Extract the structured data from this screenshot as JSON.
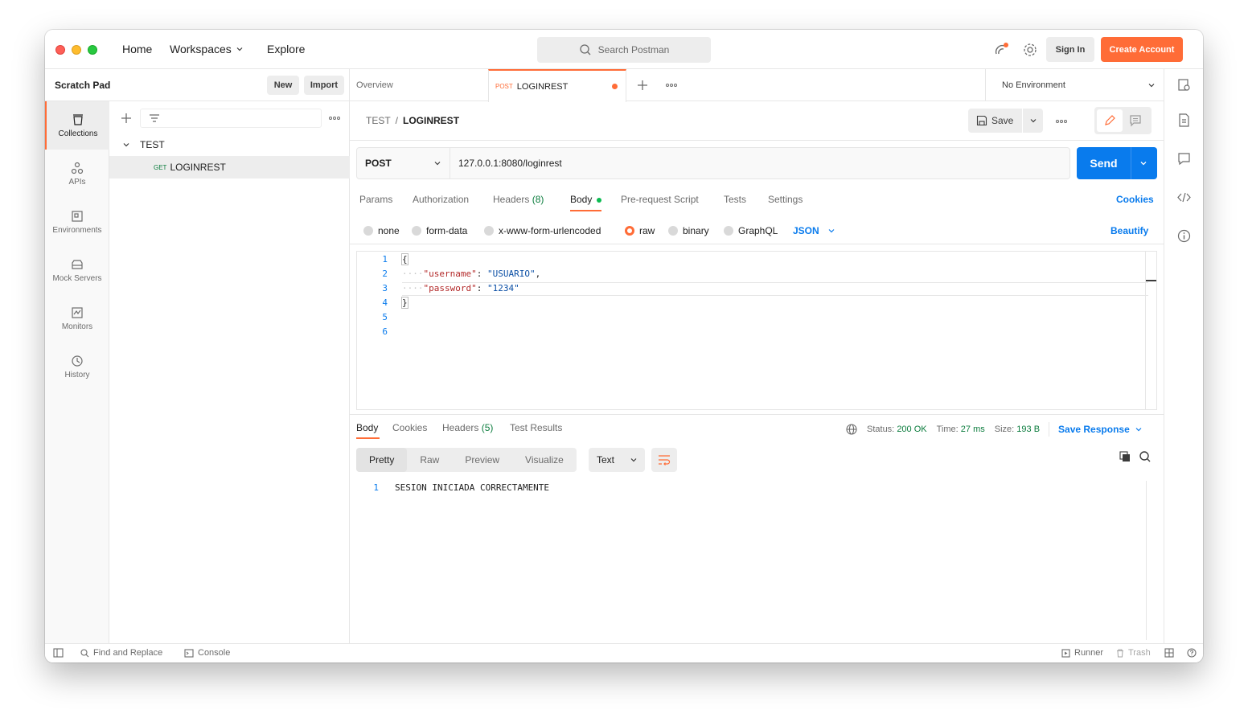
{
  "nav": {
    "home": "Home",
    "workspaces": "Workspaces",
    "explore": "Explore"
  },
  "search": {
    "placeholder": "Search Postman"
  },
  "account": {
    "sign_in": "Sign In",
    "create_account": "Create Account"
  },
  "sidebar": {
    "title": "Scratch Pad",
    "new_label": "New",
    "import_label": "Import",
    "items": [
      {
        "label": "Collections",
        "icon": "collections-icon"
      },
      {
        "label": "APIs",
        "icon": "apis-icon"
      },
      {
        "label": "Environments",
        "icon": "environments-icon"
      },
      {
        "label": "Mock Servers",
        "icon": "mock-servers-icon"
      },
      {
        "label": "Monitors",
        "icon": "monitors-icon"
      },
      {
        "label": "History",
        "icon": "history-icon"
      }
    ]
  },
  "collections": {
    "name": "TEST",
    "requests": [
      {
        "method": "GET",
        "name": "LOGINREST"
      }
    ]
  },
  "tabs": {
    "overview": "Overview",
    "active_method": "POST",
    "active_name": "LOGINREST",
    "environment": "No Environment"
  },
  "request": {
    "breadcrumb_collection": "TEST",
    "breadcrumb_separator": "/",
    "breadcrumb_name": "LOGINREST",
    "save_label": "Save",
    "method": "POST",
    "url": "127.0.0.1:8080/loginrest",
    "send_label": "Send",
    "tabs": {
      "params": "Params",
      "authorization": "Authorization",
      "headers": "Headers",
      "headers_count": "(8)",
      "body": "Body",
      "pre_request": "Pre-request Script",
      "tests": "Tests",
      "settings": "Settings",
      "cookies": "Cookies"
    },
    "body_types": {
      "none": "none",
      "form_data": "form-data",
      "urlencoded": "x-www-form-urlencoded",
      "raw": "raw",
      "binary": "binary",
      "graphql": "GraphQL",
      "selected": "raw",
      "format": "JSON",
      "beautify": "Beautify"
    },
    "body_lines": {
      "n1": "1",
      "n2": "2",
      "n3": "3",
      "n4": "4",
      "n5": "5",
      "n6": "6",
      "open_brace": "{",
      "key1": "\"username\"",
      "val1": "\"USUARIO\"",
      "key2": "\"password\"",
      "val2": "\"1234\"",
      "close_brace": "}"
    }
  },
  "response": {
    "tabs": {
      "body": "Body",
      "cookies": "Cookies",
      "headers": "Headers",
      "headers_count": "(5)",
      "test_results": "Test Results"
    },
    "status_label": "Status:",
    "status_value": "200 OK",
    "time_label": "Time:",
    "time_value": "27 ms",
    "size_label": "Size:",
    "size_value": "193 B",
    "save_response": "Save Response",
    "views": {
      "pretty": "Pretty",
      "raw": "Raw",
      "preview": "Preview",
      "visualize": "Visualize"
    },
    "format": "Text",
    "line_number": "1",
    "body_text": "SESION INICIADA CORRECTAMENTE"
  },
  "statusbar": {
    "find_replace": "Find and Replace",
    "console": "Console",
    "runner": "Runner",
    "trash": "Trash"
  },
  "colors": {
    "accent": "#ff6c37",
    "send": "#097bed",
    "success": "#0c7d3e"
  }
}
